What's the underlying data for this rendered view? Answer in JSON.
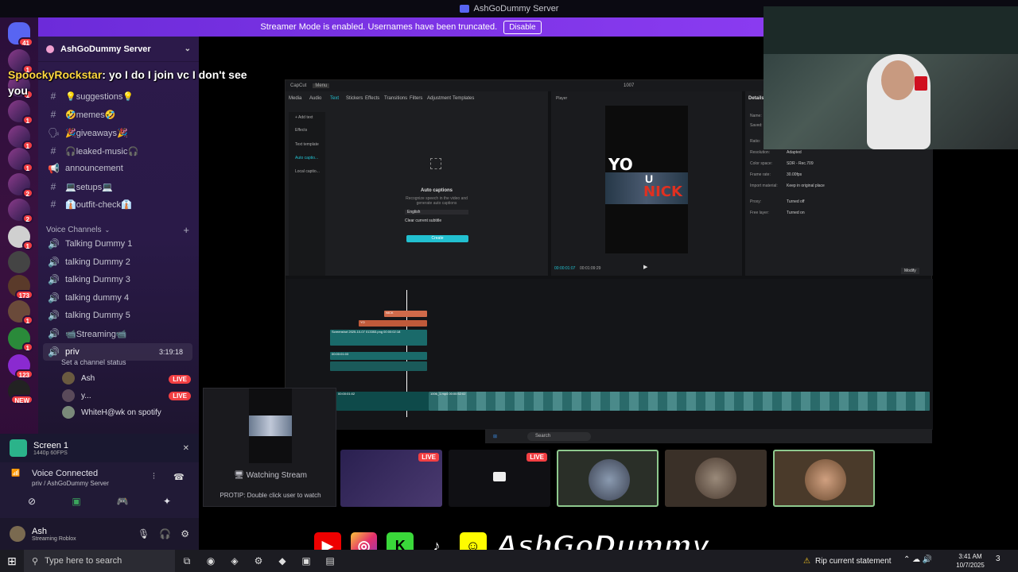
{
  "window": {
    "title": "AshGoDummy Server"
  },
  "banner": {
    "text": "Streamer Mode is enabled. Usernames have been truncated.",
    "button": "Disable"
  },
  "rail": {
    "servers": [
      {
        "badge": "41"
      },
      {
        "badge": "1"
      },
      {
        "badge": "1"
      },
      {
        "badge": "1"
      },
      {
        "badge": "1"
      },
      {
        "badge": "1"
      },
      {
        "badge": "2"
      },
      {
        "badge": "2"
      },
      {
        "badge": "1"
      },
      {
        "badge": ""
      },
      {
        "badge": "173"
      },
      {
        "badge": "1"
      },
      {
        "badge": "1"
      },
      {
        "badge": "123"
      },
      {
        "badge": "NEW"
      }
    ]
  },
  "sidebar": {
    "server_name": "AshGoDummy Server",
    "text_channels": [
      {
        "name": "💡suggestions💡",
        "icon": "#"
      },
      {
        "name": "🤣memes🤣",
        "icon": "#"
      },
      {
        "name": "🎉giveaways🎉",
        "icon": "🗣"
      },
      {
        "name": "🎧leaked-music🎧",
        "icon": "#"
      },
      {
        "name": "announcement",
        "icon": "📢"
      },
      {
        "name": "💻setups💻",
        "icon": "#"
      },
      {
        "name": "👔outfit-check👔",
        "icon": "#"
      }
    ],
    "voice_category": "Voice Channels",
    "voice_channels": [
      {
        "name": "Talking Dummy 1"
      },
      {
        "name": "talking Dummy 2"
      },
      {
        "name": "talking Dummy 3"
      },
      {
        "name": "talking dummy 4"
      },
      {
        "name": "talking Dummy 5"
      },
      {
        "name": "📹Streaming📹"
      }
    ],
    "active_voice": {
      "name": "priv",
      "time": "3:19:18",
      "status": "Set a channel status"
    },
    "voice_users": [
      {
        "name": "Ash",
        "live": "LIVE"
      },
      {
        "name": "y...",
        "live": "LIVE"
      },
      {
        "name": "WhiteH@wk on spotify",
        "live": ""
      }
    ]
  },
  "chat": {
    "user": "SpoockyRockstar",
    "message": ": yo I do I join vc I don't see you"
  },
  "screen_panel": {
    "title": "Screen 1",
    "sub": "1440p 60FPS"
  },
  "voice_panel": {
    "title": "Voice Connected",
    "sub": "priv / AshGoDummy Server"
  },
  "user_panel": {
    "name": "Ash",
    "status": "Streaming Roblox"
  },
  "editor": {
    "app": "CapCut",
    "menu": "Menu",
    "project": "1007",
    "tabs": [
      "Media",
      "Audio",
      "Text",
      "Stickers",
      "Effects",
      "Transitions",
      "Filters",
      "Adjustment",
      "Templates"
    ],
    "left_menu": [
      "+ Add text",
      "Effects",
      "Text template",
      "Auto captio...",
      "Local captio..."
    ],
    "auto_captions_title": "Auto captions",
    "auto_captions_desc": "Recognize speech in the video and generate auto captions",
    "language": "English",
    "clear_label": "Clear current subtitle",
    "create": "Create",
    "player_label": "Player",
    "video_text_top": "YO",
    "video_text_mid": "U",
    "video_text_bot": "NICK",
    "time_current": "00:00:01:07",
    "time_total": "00:01:09:29",
    "details_label": "Details",
    "details": [
      {
        "k": "Name:",
        "v": ""
      },
      {
        "k": "Saved:",
        "v": ""
      },
      {
        "k": "Ratio:",
        "v": ""
      },
      {
        "k": "Resolution:",
        "v": "Adapted"
      },
      {
        "k": "Color space:",
        "v": "SDR - Rec.709"
      },
      {
        "k": "Frame rate:",
        "v": "30.00fps"
      },
      {
        "k": "Import material:",
        "v": "Keep in original place"
      },
      {
        "k": "Proxy:",
        "v": "Turned off"
      },
      {
        "k": "Free layer:",
        "v": "Turned on"
      }
    ],
    "modify": "Modify",
    "clip_nick": "NICK",
    "clip_yo": "YO",
    "clip_screenshot": "Screenshot 2025-10-07 013353.png  00:00:02:18",
    "clip_audio": "00:00:01:03",
    "clip_main": "00:00:01:02",
    "clip_main2": "1006_1.mp4  00:00:52:02",
    "task_search": "Search"
  },
  "pip": {
    "watching": "Watching Stream",
    "protip": "PROTIP: Double click user to watch"
  },
  "tiles": [
    {
      "live": "LIVE"
    },
    {
      "live": "LIVE"
    },
    {
      "live": ""
    },
    {
      "live": ""
    },
    {
      "live": ""
    }
  ],
  "brand": {
    "name": "AshGoDummy"
  },
  "taskbar": {
    "search": "Type here to search",
    "weather": "Rip current statement",
    "time": "3:41 AM",
    "date": "10/7/2025",
    "notif": "3"
  }
}
